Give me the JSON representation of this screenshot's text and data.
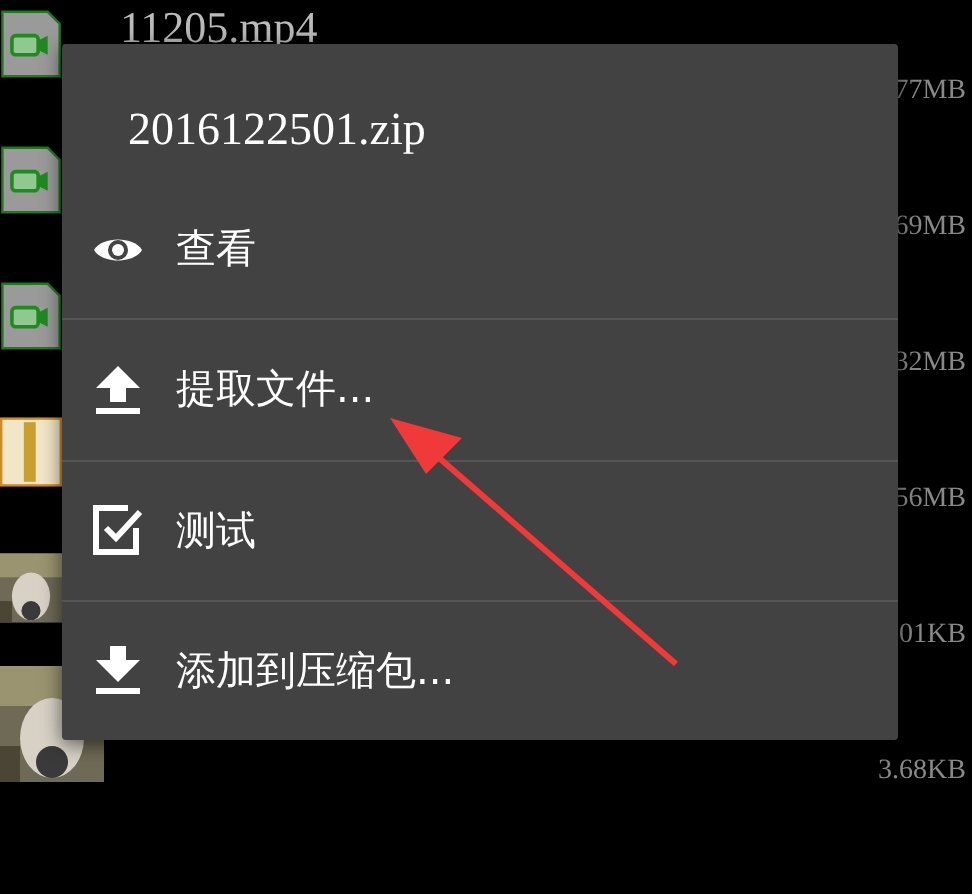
{
  "files": [
    {
      "kind": "video",
      "name": "11205.mp4",
      "size": "77MB"
    },
    {
      "kind": "video",
      "size": "69MB"
    },
    {
      "kind": "video",
      "size": "32MB"
    },
    {
      "kind": "zip",
      "size": "56MB"
    },
    {
      "kind": "picture",
      "size": "01KB"
    },
    {
      "kind": "picture",
      "size": "3.68KB"
    }
  ],
  "dialog": {
    "title": "2016122501.zip",
    "items": [
      {
        "kind": "view",
        "label": "查看"
      },
      {
        "kind": "extract",
        "label": "提取文件..."
      },
      {
        "kind": "test",
        "label": "测试"
      },
      {
        "kind": "add",
        "label": "添加到压缩包..."
      }
    ]
  }
}
